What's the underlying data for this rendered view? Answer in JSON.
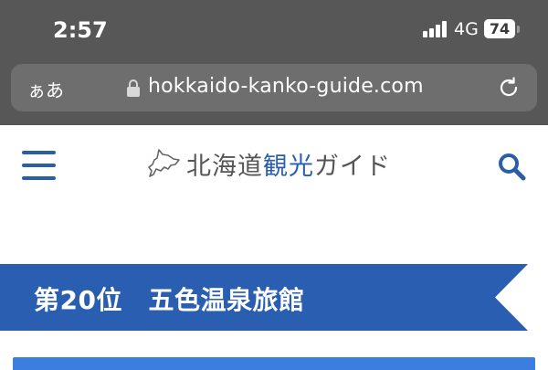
{
  "status_bar": {
    "time": "2:57",
    "network": "4G",
    "battery": 74
  },
  "browser": {
    "reader_label": "ぁあ",
    "url": "hokkaido-kanko-guide.com",
    "lock_icon": "lock-icon",
    "reload_icon": "reload-icon"
  },
  "site_header": {
    "logo_prefix": "北海道",
    "logo_accent": "観光",
    "logo_suffix": "ガイド",
    "menu_icon": "hamburger-menu-icon",
    "search_icon": "search-icon"
  },
  "ranking": {
    "title": "第20位　五色温泉旅館"
  },
  "colors": {
    "brand_blue": "#2a5ea8",
    "banner_blue": "#2a5eb0",
    "chrome_gray": "#575757",
    "url_bar_gray": "#6e6e6e",
    "strip_blue": "#3c7de0"
  }
}
